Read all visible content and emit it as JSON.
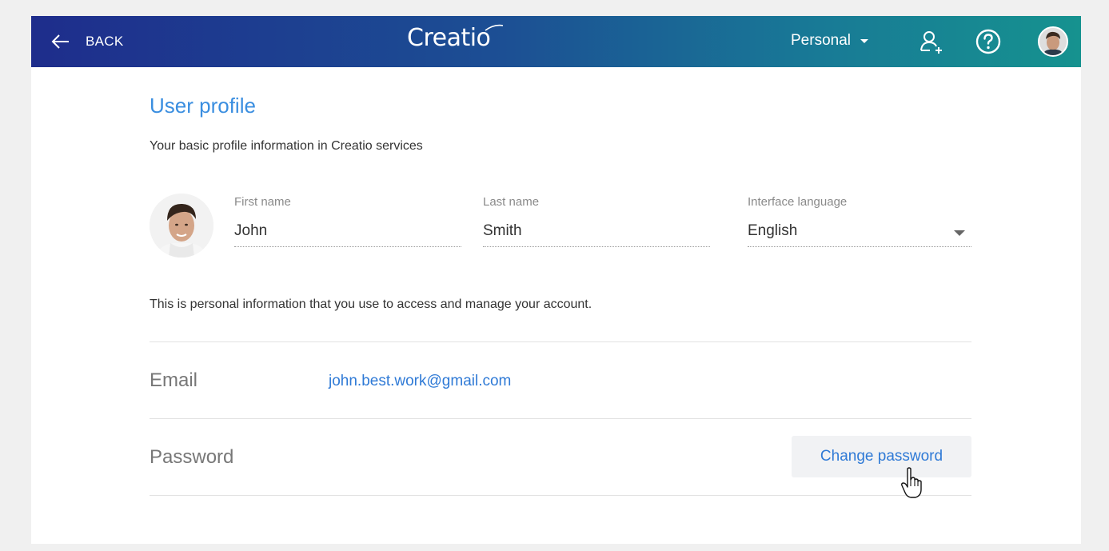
{
  "header": {
    "back_label": "BACK",
    "logo_text": "Creatio",
    "workspace_label": "Personal"
  },
  "profile": {
    "title": "User profile",
    "subtitle": "Your basic profile information in Creatio services",
    "fields": {
      "first_name": {
        "label": "First name",
        "value": "John"
      },
      "last_name": {
        "label": "Last name",
        "value": "Smith"
      },
      "language": {
        "label": "Interface language",
        "value": "English"
      }
    },
    "info_text": "This is personal information that you use to access and manage your account."
  },
  "account": {
    "email_label": "Email",
    "email_value": "john.best.work@gmail.com",
    "password_label": "Password",
    "change_password_label": "Change password"
  },
  "icons": {
    "back": "arrow-left-icon",
    "add_user": "add-user-icon",
    "help": "help-icon",
    "caret": "chevron-down-icon",
    "cursor": "hand-pointer-icon"
  },
  "colors": {
    "header_start": "#1e2d8c",
    "header_end": "#16928f",
    "accent": "#3a8ee0",
    "link": "#2f7ad6"
  }
}
